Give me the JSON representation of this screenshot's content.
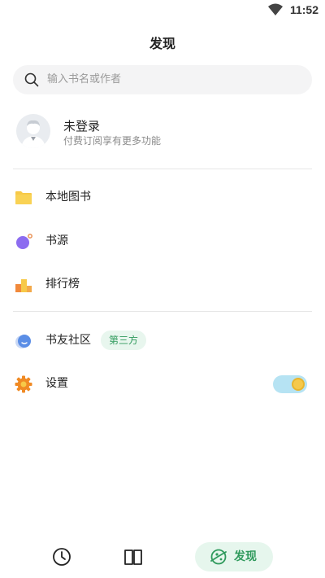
{
  "status_bar": {
    "time": "11:52",
    "wifi_icon": "wifi-icon"
  },
  "header": {
    "title": "发现"
  },
  "search": {
    "placeholder": "输入书名或作者",
    "icon": "search-icon"
  },
  "account": {
    "name": "未登录",
    "subtitle": "付费订阅享有更多功能"
  },
  "menu": [
    {
      "label": "本地图书",
      "icon": "folder-icon"
    },
    {
      "label": "书源",
      "icon": "source-icon"
    },
    {
      "label": "排行榜",
      "icon": "ranking-icon"
    }
  ],
  "community": {
    "label": "书友社区",
    "badge": "第三方",
    "icon": "chat-bubble-icon"
  },
  "settings": {
    "label": "设置",
    "icon": "gear-icon",
    "toggle_on": true
  },
  "bottom_nav": {
    "history_icon": "clock-icon",
    "bookshelf_icon": "book-open-icon",
    "discover_label": "发现",
    "discover_icon": "planet-icon"
  },
  "colors": {
    "accent_green": "#2f9a5c",
    "accent_green_bg": "#e6f6ed",
    "folder_yellow": "#f7c948",
    "source_purple": "#8c6cf0",
    "toggle_track": "#b6e3f3",
    "toggle_knob": "#f6c94a"
  }
}
